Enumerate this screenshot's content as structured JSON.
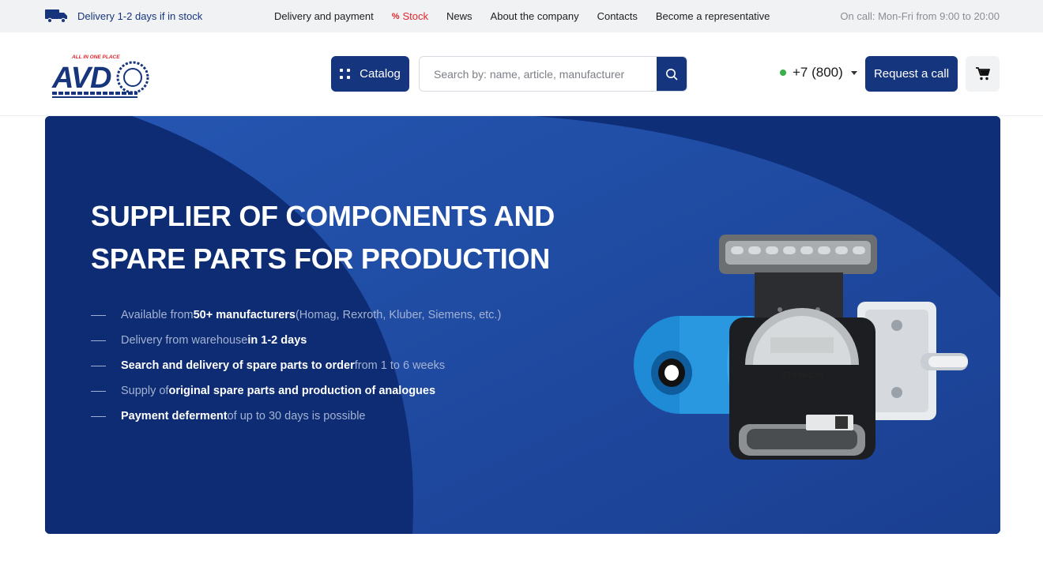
{
  "topbar": {
    "delivery_text": "Delivery 1-2 days if in stock",
    "nav": [
      {
        "label": "Delivery and payment"
      },
      {
        "label": "Stock",
        "icon": "percent-icon"
      },
      {
        "label": "News"
      },
      {
        "label": "About the company"
      },
      {
        "label": "Contacts"
      },
      {
        "label": "Become a representative"
      }
    ],
    "oncall": "On call: Mon-Fri from 9:00 to 20:00"
  },
  "header": {
    "logo_tagline": "ALL IN ONE PLACE",
    "logo_text": "AVD",
    "catalog_label": "Catalog",
    "search_placeholder": "Search by: name, article, manufacturer",
    "phone": "+7 (800)",
    "request_call_label": "Request a call"
  },
  "hero": {
    "title": "SUPPLIER OF COMPONENTS AND SPARE PARTS FOR PRODUCTION",
    "bullets": [
      {
        "pre": "Available from ",
        "bold": "50+ manufacturers",
        "post": " (Homag, Rexroth, Kluber, Siemens, etc.)"
      },
      {
        "pre": "Delivery from warehouse ",
        "bold": "in 1-2 days",
        "post": ""
      },
      {
        "pre": "",
        "bold": "Search and delivery of spare parts to order",
        "post": " from 1 to 6 weeks"
      },
      {
        "pre": "Supply of ",
        "bold": "original spare parts and production of analogues",
        "post": ""
      },
      {
        "pre": "",
        "bold": "Payment deferment",
        "post": " of up to 30 days is possible"
      }
    ]
  },
  "colors": {
    "brand_navy": "#15357f",
    "stock_red": "#e0262f",
    "online_green": "#3cae4a"
  }
}
